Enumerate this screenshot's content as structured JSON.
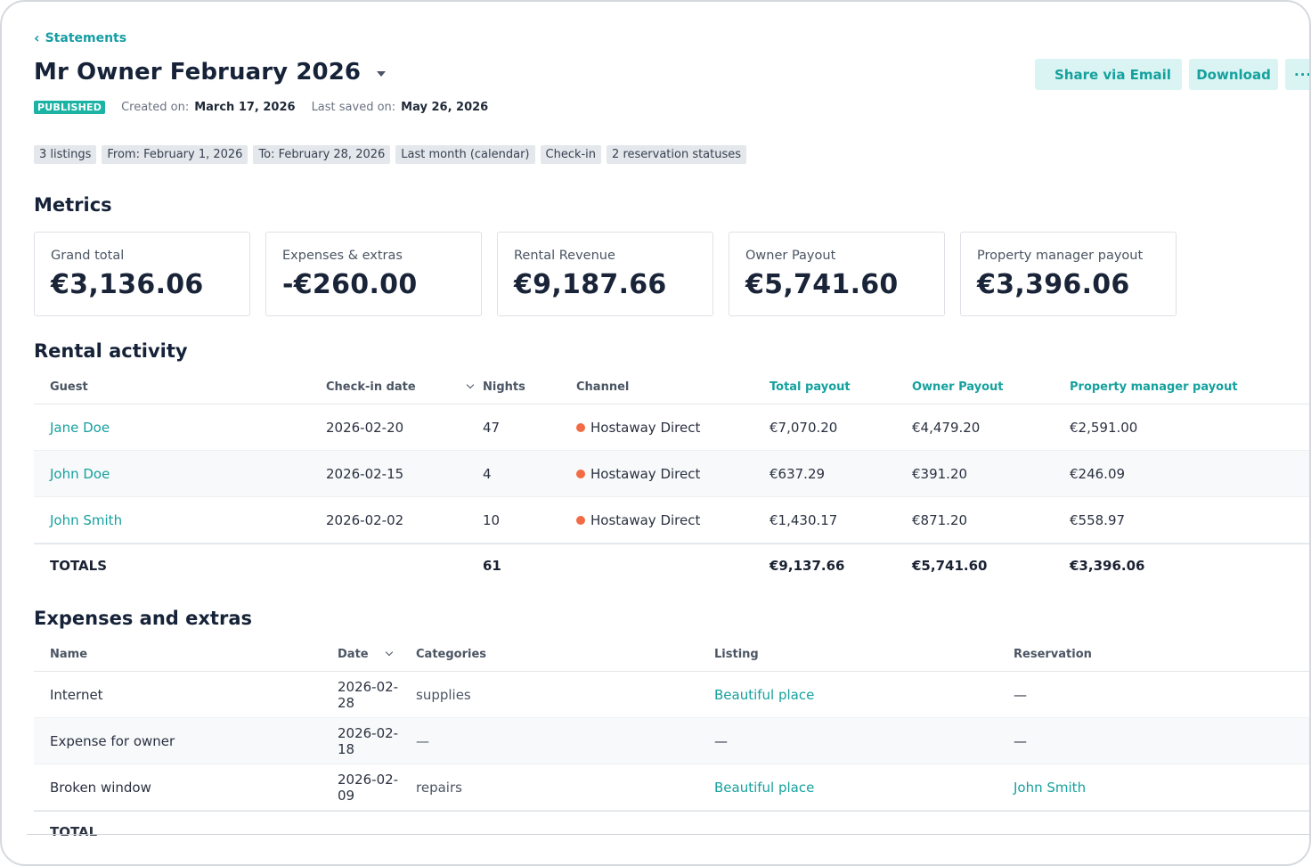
{
  "header": {
    "back_label": "Statements",
    "title": "Mr Owner February 2026",
    "status_badge": "PUBLISHED",
    "created_label": "Created on:",
    "created_value": "March 17, 2026",
    "saved_label": "Last saved on:",
    "saved_value": "May 26, 2026"
  },
  "actions": {
    "share_label": "Share via Email",
    "download_label": "Download",
    "more_label": "···"
  },
  "filters": [
    "3 listings",
    "From: February 1, 2026",
    "To: February 28, 2026",
    "Last month (calendar)",
    "Check-in",
    "2 reservation statuses"
  ],
  "metrics": {
    "heading": "Metrics",
    "cards": [
      {
        "label": "Grand total",
        "value": "€3,136.06"
      },
      {
        "label": "Expenses & extras",
        "value": "-€260.00"
      },
      {
        "label": "Rental Revenue",
        "value": "€9,187.66"
      },
      {
        "label": "Owner Payout",
        "value": "€5,741.60"
      },
      {
        "label": "Property manager payout",
        "value": "€3,396.06"
      }
    ]
  },
  "rental": {
    "heading": "Rental activity",
    "columns": {
      "guest": "Guest",
      "checkin": "Check-in date",
      "nights": "Nights",
      "channel": "Channel",
      "total": "Total payout",
      "owner": "Owner Payout",
      "pm": "Property manager payout"
    },
    "rows": [
      {
        "guest": "Jane Doe",
        "checkin": "2026-02-20",
        "nights": "47",
        "channel": "Hostaway Direct",
        "total": "€7,070.20",
        "owner": "€4,479.20",
        "pm": "€2,591.00"
      },
      {
        "guest": "John Doe",
        "checkin": "2026-02-15",
        "nights": "4",
        "channel": "Hostaway Direct",
        "total": "€637.29",
        "owner": "€391.20",
        "pm": "€246.09"
      },
      {
        "guest": "John Smith",
        "checkin": "2026-02-02",
        "nights": "10",
        "channel": "Hostaway Direct",
        "total": "€1,430.17",
        "owner": "€871.20",
        "pm": "€558.97"
      }
    ],
    "totals": {
      "label": "TOTALS",
      "nights": "61",
      "total": "€9,137.66",
      "owner": "€5,741.60",
      "pm": "€3,396.06"
    },
    "channel_dot_color": "#f26b43"
  },
  "expenses": {
    "heading": "Expenses and extras",
    "columns": {
      "name": "Name",
      "date": "Date",
      "categories": "Categories",
      "listing": "Listing",
      "reservation": "Reservation"
    },
    "rows": [
      {
        "name": "Internet",
        "date": "2026-02-28",
        "categories": "supplies",
        "listing": "Beautiful place",
        "reservation": "—"
      },
      {
        "name": "Expense for owner",
        "date": "2026-02-18",
        "categories": "—",
        "listing": "—",
        "reservation": "—"
      },
      {
        "name": "Broken window",
        "date": "2026-02-09",
        "categories": "repairs",
        "listing": "Beautiful place",
        "reservation": "John Smith"
      }
    ],
    "total_label": "TOTAL"
  },
  "colors": {
    "accent": "#15a19e",
    "badge": "#1bb3a4",
    "button_bg": "#d9f4f2"
  }
}
